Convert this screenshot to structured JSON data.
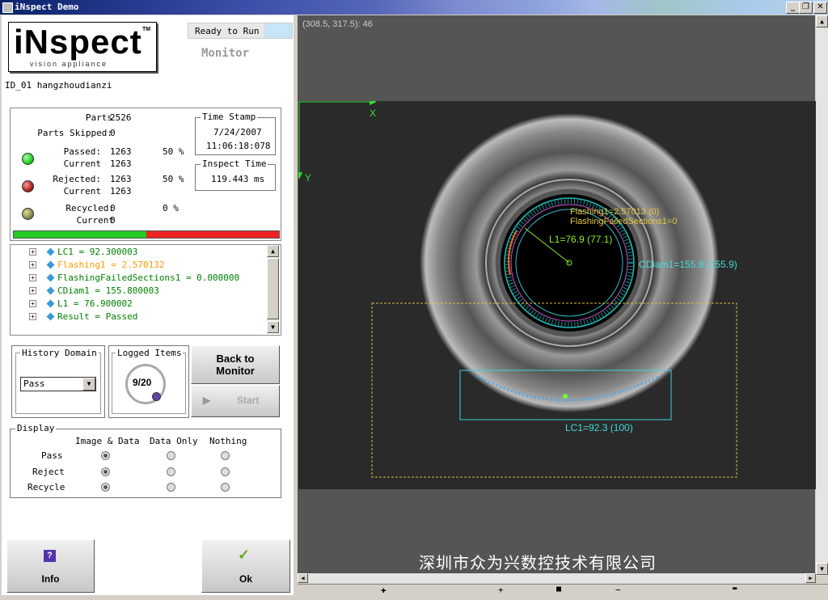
{
  "window": {
    "title": "iNspect Demo"
  },
  "logo": {
    "brand": "iNspect",
    "tagline": "vision appliance"
  },
  "status": {
    "state": "Ready to Run",
    "mode": "Monitor"
  },
  "id_line": "ID_01  hangzhoudianzi",
  "stats": {
    "parts_label": "Parts",
    "parts": "2526",
    "skipped_label": "Parts Skipped:",
    "skipped": "0",
    "passed_label": "Passed:",
    "passed": "1263",
    "passed_pct": "50 %",
    "rejected_label": "Rejected:",
    "rejected": "1263",
    "rejected_pct": "50 %",
    "recycled_label": "Recycled:",
    "recycled": "0",
    "recycled_pct": "0 %",
    "current_label": "Current",
    "passed_current": "1263",
    "rejected_current": "1263",
    "recycled_current": "0",
    "timestamp_title": "Time Stamp",
    "date": "7/24/2007",
    "time": "11:06:18:078",
    "inspect_title": "Inspect Time",
    "inspect_time": "119.443 ms",
    "pass_fraction": 0.5,
    "colors": {
      "pass": "#22cc22",
      "reject": "#ee2222",
      "recycle": "#8a7a1a"
    }
  },
  "tree": [
    {
      "text": "LC1 = 92.300003",
      "color": "#008000"
    },
    {
      "text": "Flashing1 = 2.570132",
      "color": "#ff9900"
    },
    {
      "text": "FlashingFailedSections1 = 0.000000",
      "color": "#008000"
    },
    {
      "text": "CDiam1 = 155.800003",
      "color": "#008000"
    },
    {
      "text": "L1 = 76.900002",
      "color": "#008000"
    },
    {
      "text": "Result = Passed",
      "color": "#008000"
    }
  ],
  "history": {
    "title": "History Domain",
    "selected": "Pass"
  },
  "logged": {
    "title": "Logged Items",
    "count": "9/20"
  },
  "buttons": {
    "back_to_monitor": "Back to\nMonitor",
    "start": "Start",
    "info": "Info",
    "ok": "Ok"
  },
  "display": {
    "title": "Display",
    "columns": [
      "Image & Data",
      "Data Only",
      "Nothing"
    ],
    "rows": [
      "Pass",
      "Reject",
      "Recycle"
    ]
  },
  "image": {
    "coords": "(308.5, 317.5): 46",
    "axis_x": "X",
    "axis_y": "Y",
    "flashing_label": "Flashing1=2.57013 (0)",
    "failed_label": "FlashingFailedSections1=0",
    "l1_label": "L1=76.9 (77.1)",
    "cdiam_label": "CDiam1=155.8 (155.9)",
    "lc1_label": "LC1=92.3 (100)",
    "watermark": "深圳市众为兴数控技术有限公司"
  },
  "zoom_bar": {
    "zoom_in": "✚",
    "plus": "+",
    "stop": "■",
    "minus": "−",
    "zoom_out": "▬"
  }
}
